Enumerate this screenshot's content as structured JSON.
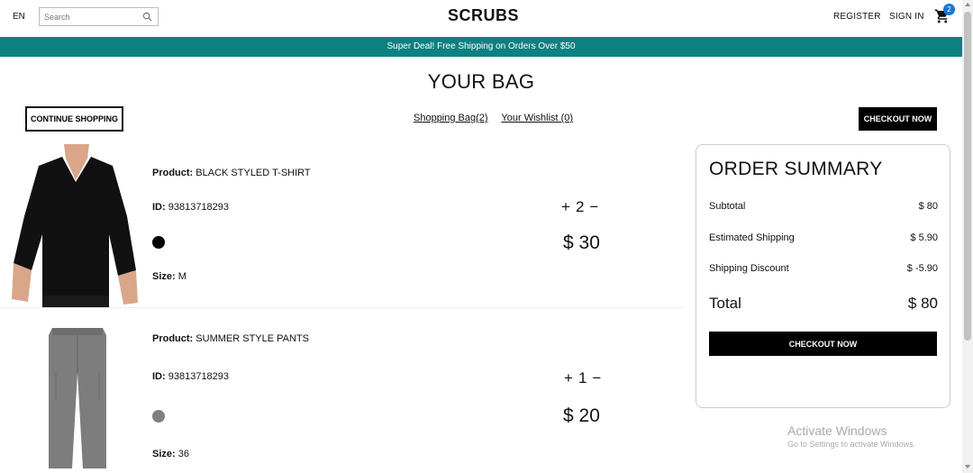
{
  "nav": {
    "language": "EN",
    "search_placeholder": "Search",
    "logo": "SCRUBS",
    "register": "REGISTER",
    "sign_in": "SIGN IN",
    "cart_count": "2"
  },
  "announcement": "Super Deal! Free Shipping on Orders Over $50",
  "page_title": "YOUR BAG",
  "top_actions": {
    "continue_shopping": "CONTINUE SHOPPING",
    "shopping_bag_link": "Shopping Bag(2)",
    "wishlist_link": "Your Wishlist (0)",
    "checkout_now": "CHECKOUT NOW"
  },
  "products": [
    {
      "product_label": "Product:",
      "product_name": "BLACK STYLED T-SHIRT",
      "id_label": "ID:",
      "id": "93813718293",
      "color": "#000000",
      "size_label": "Size:",
      "size": "M",
      "quantity": "2",
      "price": "$ 30"
    },
    {
      "product_label": "Product:",
      "product_name": "SUMMER STYLE PANTS",
      "id_label": "ID:",
      "id": "93813718293",
      "color": "#808080",
      "size_label": "Size:",
      "size": "36",
      "quantity": "1",
      "price": "$ 20"
    }
  ],
  "summary": {
    "title": "ORDER SUMMARY",
    "subtotal_label": "Subtotal",
    "subtotal": "$ 80",
    "shipping_label": "Estimated Shipping",
    "shipping": "$ 5.90",
    "discount_label": "Shipping Discount",
    "discount": "$ -5.90",
    "total_label": "Total",
    "total": "$ 80",
    "checkout": "CHECKOUT NOW"
  },
  "watermark": {
    "line1": "Activate Windows",
    "line2": "Go to Settings to activate Windows."
  }
}
